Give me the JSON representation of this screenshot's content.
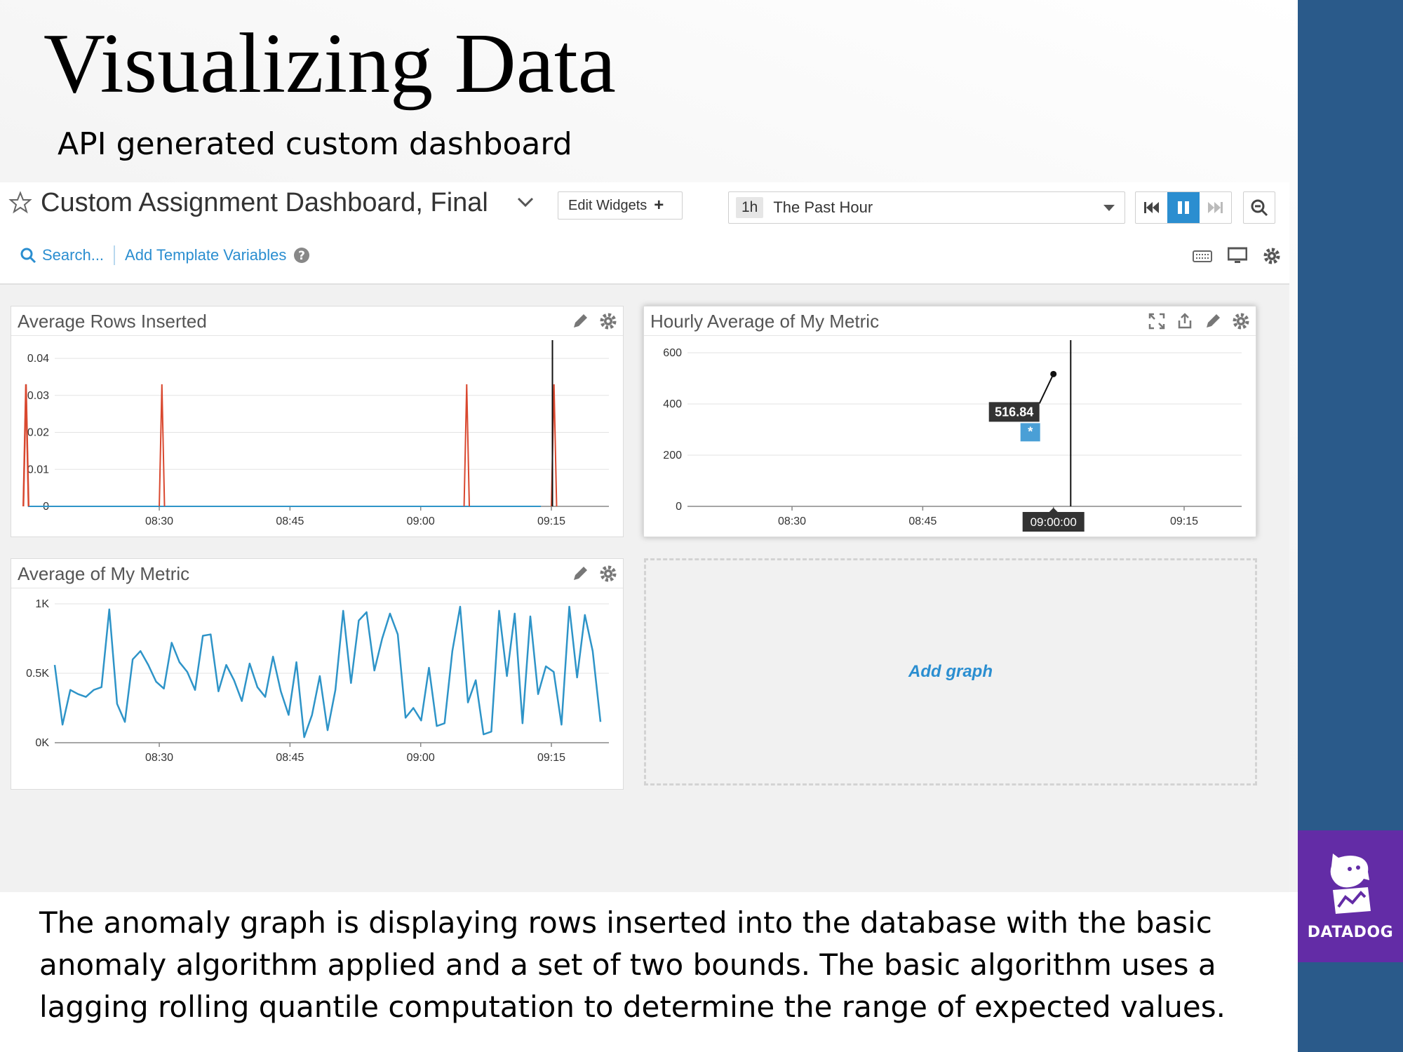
{
  "slide": {
    "title": "Visualizing Data",
    "subtitle": "API generated custom dashboard",
    "caption": "The anomaly graph is displaying rows inserted into the database with the basic anomaly algorithm applied and a set of two bounds. The basic algorithm uses a lagging rolling quantile computation to determine the range of expected values.",
    "logo_text": "DATADOG"
  },
  "colors": {
    "accent": "#2b8ed0",
    "series_blue": "#2e94c8",
    "anomaly_red": "#d9482f",
    "datadog_purple": "#632ca6",
    "stripe_blue": "#2a5a8a"
  },
  "dashboard": {
    "title": "Custom Assignment Dashboard, Final",
    "edit_widgets": "Edit Widgets",
    "time_badge": "1h",
    "time_range": "The Past Hour",
    "search_label": "Search...",
    "template_variables": "Add Template Variables",
    "add_graph": "Add graph",
    "icons": [
      "star-icon",
      "chevron-down-icon",
      "plus-icon",
      "caret-down-icon",
      "rewind-icon",
      "pause-icon",
      "fast-forward-icon",
      "zoom-out-icon",
      "search-icon",
      "help-icon",
      "keyboard-icon",
      "monitor-icon",
      "gear-icon",
      "pencil-icon",
      "expand-icon",
      "share-icon"
    ]
  },
  "panels": {
    "rows_inserted": {
      "title": "Average Rows Inserted"
    },
    "hourly_average": {
      "title": "Hourly Average of My Metric",
      "tooltip_value": "516.84",
      "tooltip_marker": "*",
      "hover_time": "09:00:00"
    },
    "average_metric": {
      "title": "Average of My Metric"
    }
  },
  "chart_data": [
    {
      "type": "line",
      "title": "Average Rows Inserted",
      "x_ticks": [
        "08:30",
        "08:45",
        "09:00",
        "09:15"
      ],
      "y_ticks": [
        "0",
        "0.01",
        "0.02",
        "0.03",
        "0.04"
      ],
      "ylim": [
        0,
        0.04
      ],
      "grid": true,
      "series": [
        {
          "values": [
            [
              8.24,
              0
            ],
            [
              8.245,
              0.033
            ],
            [
              8.25,
              0
            ],
            [
              9.23,
              0
            ]
          ]
        },
        {
          "values": [
            [
              8.5,
              0
            ],
            [
              8.505,
              0.033
            ],
            [
              8.51,
              0
            ]
          ]
        },
        {
          "values": [
            [
              9.083,
              0
            ],
            [
              9.088,
              0.033
            ],
            [
              9.093,
              0
            ]
          ]
        },
        {
          "values": [
            [
              9.25,
              0
            ],
            [
              9.255,
              0.033
            ],
            [
              9.26,
              0
            ]
          ]
        }
      ],
      "marker_x": 9.252
    },
    {
      "type": "line",
      "title": "Hourly Average of My Metric",
      "x_ticks": [
        "08:30",
        "08:45",
        "09:00",
        "09:15"
      ],
      "y_ticks": [
        "0",
        "200",
        "400",
        "600"
      ],
      "ylim": [
        0,
        600
      ],
      "grid": true,
      "series": [
        {
          "values": [
            [
              9.0,
              516.84
            ]
          ]
        }
      ],
      "marker_x": 9.033
    },
    {
      "type": "line",
      "title": "Average of My Metric",
      "x_ticks": [
        "08:30",
        "08:45",
        "09:00",
        "09:15"
      ],
      "y_ticks": [
        "0K",
        "0.5K",
        "1K"
      ],
      "ylim": [
        0,
        1000
      ],
      "grid": true,
      "series": [
        {
          "values": [
            560,
            130,
            380,
            350,
            330,
            380,
            400,
            960,
            280,
            150,
            600,
            660,
            560,
            440,
            390,
            720,
            580,
            510,
            380,
            770,
            780,
            370,
            560,
            450,
            300,
            570,
            400,
            330,
            620,
            370,
            200,
            580,
            40,
            200,
            480,
            90,
            380,
            950,
            430,
            880,
            940,
            520,
            750,
            930,
            780,
            180,
            250,
            160,
            540,
            120,
            140,
            660,
            980,
            290,
            450,
            60,
            80,
            950,
            480,
            930,
            140,
            910,
            350,
            550,
            510,
            130,
            980,
            470,
            920,
            660,
            150
          ]
        }
      ]
    }
  ]
}
